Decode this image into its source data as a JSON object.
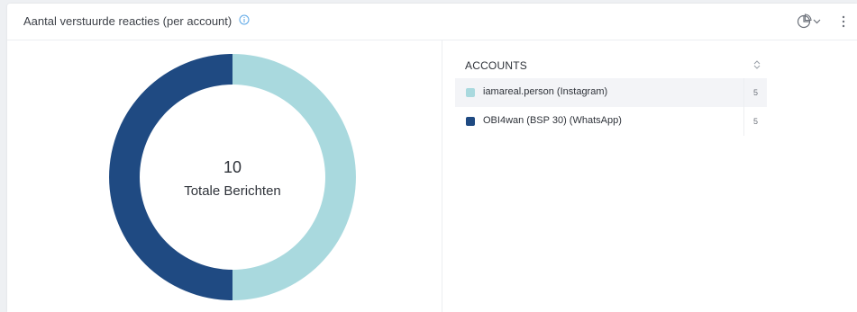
{
  "widget": {
    "title": "Aantal verstuurde reacties (per account)",
    "info_icon": "info-icon",
    "chart_type_icon": "pie-chart-icon",
    "dropdown_icon": "chevron-down-icon",
    "menu_icon": "vertical-dots-icon"
  },
  "donut": {
    "center_value": "10",
    "center_label": "Totale Berichten"
  },
  "table": {
    "header_accounts": "ACCOUNTS",
    "header_sort_icon": "sort-icon",
    "rows": [
      {
        "label": "iamareal.person (Instagram)",
        "value": "5",
        "color": "#a9d9de",
        "highlighted": true
      },
      {
        "label": "OBI4wan (BSP 30) (WhatsApp)",
        "value": "5",
        "color": "#1f4a82",
        "highlighted": false
      }
    ]
  },
  "chart_data": {
    "type": "pie",
    "donut": true,
    "title": "Aantal verstuurde reacties (per account)",
    "center_text": [
      "10",
      "Totale Berichten"
    ],
    "categories": [
      "iamareal.person (Instagram)",
      "OBI4wan (BSP 30) (WhatsApp)"
    ],
    "values": [
      5,
      5
    ],
    "colors": [
      "#a9d9de",
      "#1f4a82"
    ],
    "total": 10
  }
}
